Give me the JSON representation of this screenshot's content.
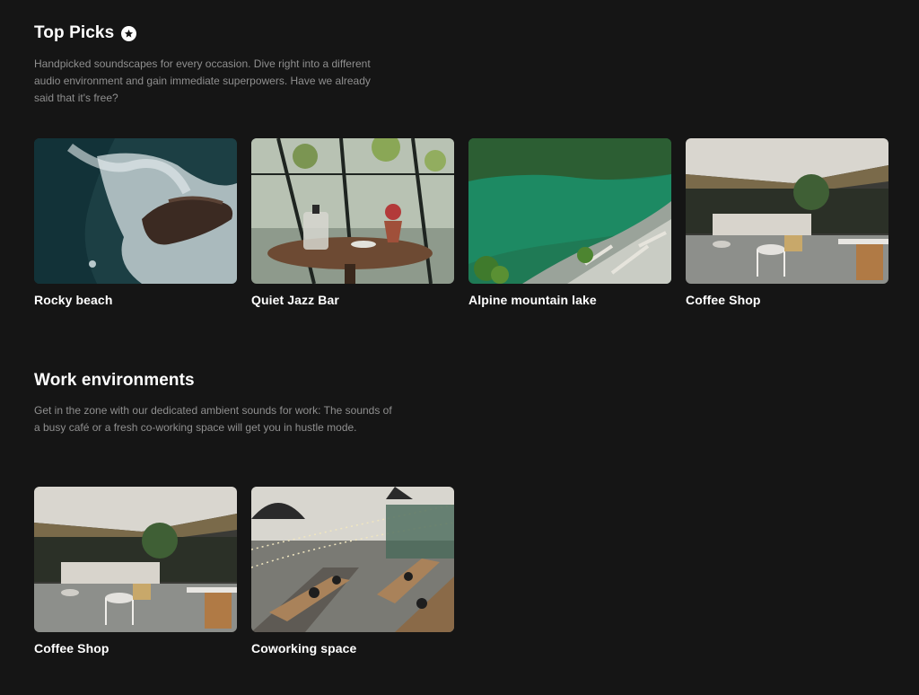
{
  "top_picks": {
    "title": "Top Picks",
    "badge_icon": "star-circle-icon",
    "description": "Handpicked soundscapes for every occasion. Dive right into a different audio environment and gain immediate superpowers. Have we already said that it's free?",
    "cards": [
      {
        "label": "Rocky beach",
        "image": "rocky-beach-image"
      },
      {
        "label": "Quiet Jazz Bar",
        "image": "jazz-bar-image"
      },
      {
        "label": "Alpine mountain lake",
        "image": "alpine-lake-image"
      },
      {
        "label": "Coffee Shop",
        "image": "coffee-shop-image"
      }
    ]
  },
  "work_environments": {
    "title": "Work environments",
    "description": "Get in the zone with our dedicated ambient sounds for work: The sounds of a busy café or a fresh co-working space will get you in hustle mode.",
    "cards": [
      {
        "label": "Coffee Shop",
        "image": "coffee-shop-image"
      },
      {
        "label": "Coworking space",
        "image": "coworking-space-image"
      }
    ]
  },
  "colors": {
    "background": "#151515",
    "text": "#ffffff",
    "muted": "#8f8f8f"
  }
}
